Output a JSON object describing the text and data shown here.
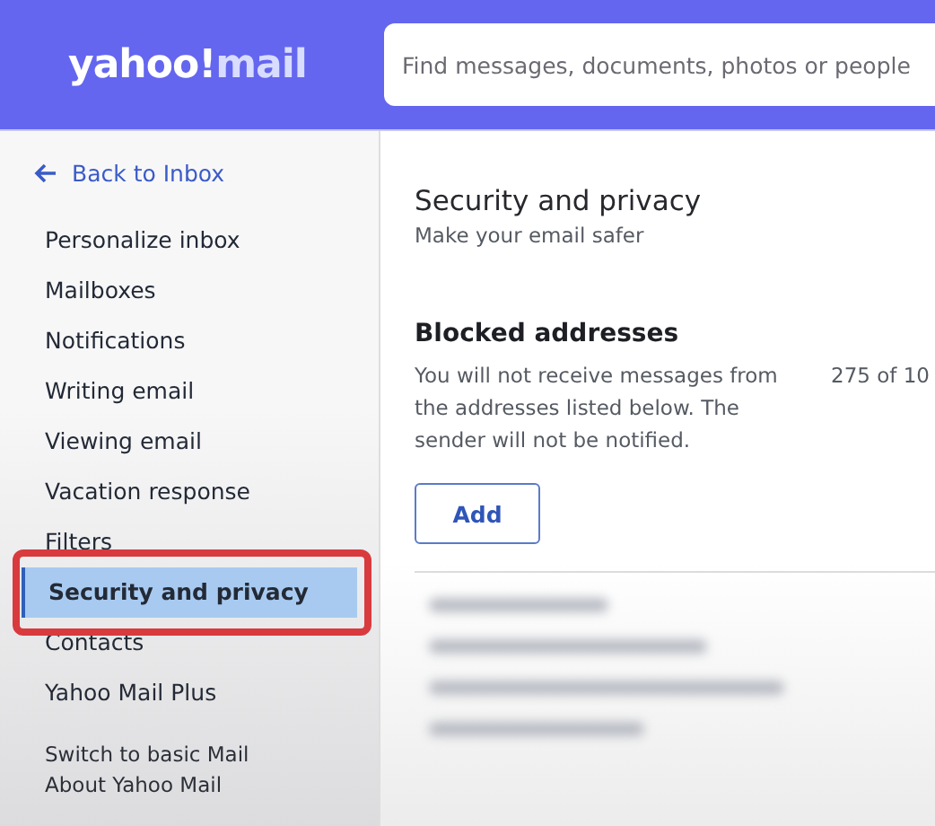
{
  "header": {
    "logo": {
      "brand": "yahoo!",
      "product": "mail"
    },
    "search": {
      "placeholder": "Find messages, documents, photos or people"
    }
  },
  "sidebar": {
    "back_link": "Back to Inbox",
    "items": [
      {
        "label": "Personalize inbox",
        "selected": false
      },
      {
        "label": "Mailboxes",
        "selected": false
      },
      {
        "label": "Notifications",
        "selected": false
      },
      {
        "label": "Writing email",
        "selected": false
      },
      {
        "label": "Viewing email",
        "selected": false
      },
      {
        "label": "Vacation response",
        "selected": false
      },
      {
        "label": "Filters",
        "selected": false
      },
      {
        "label": "Security and privacy",
        "selected": true,
        "highlighted": true
      },
      {
        "label": "Contacts",
        "selected": false
      },
      {
        "label": "Yahoo Mail Plus",
        "selected": false
      }
    ],
    "footer_links": [
      "Switch to basic Mail",
      "About Yahoo Mail"
    ]
  },
  "main": {
    "title": "Security and privacy",
    "subtitle": "Make your email safer",
    "blocked": {
      "heading": "Blocked addresses",
      "description": "You will not receive messages from the addresses listed below. The sender will not be notified.",
      "count": "275 of 10",
      "add_button": "Add",
      "entries": [
        {
          "kind": "blurred"
        },
        {
          "kind": "blurred"
        },
        {
          "kind": "blurred"
        },
        {
          "kind": "blurred"
        }
      ]
    }
  }
}
